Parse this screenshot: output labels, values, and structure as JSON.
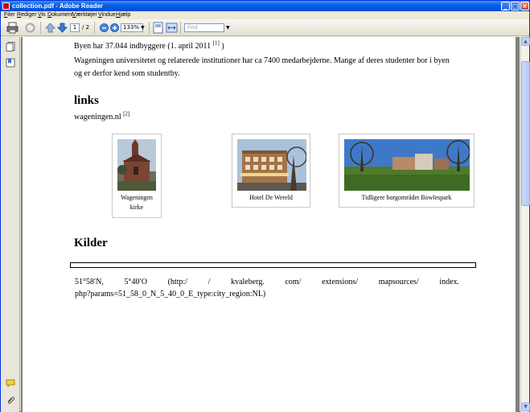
{
  "window": {
    "title": "collection.pdf - Adobe Reader",
    "controls": [
      "_",
      "□",
      "×"
    ]
  },
  "menu": [
    "Filer",
    "Rediger",
    "Vis",
    "Dokument",
    "Værktøjer",
    "Vindue",
    "Hjælp"
  ],
  "toolbar": {
    "page_current": "1",
    "page_total": "/ 2",
    "zoom": "133%",
    "find_placeholder": "Find"
  },
  "document": {
    "line1": "Byen har 37.044 indbyggere (1. april 2011 ",
    "line1_ref": "[1]",
    "line1_end": " )",
    "para2_line1": "Wageningen universitetet og relaterede institutioner har ca 7400 medarbejderne. Mange af deres studenter bor i byen",
    "para2_line2": "og er derfor kend som studentby.",
    "links_heading": "links",
    "link_text": "wageningen.nl ",
    "link_ref": "[2]",
    "figures": [
      {
        "caption_line1": "Wageningen",
        "caption_line2": "kirke"
      },
      {
        "caption_line1": "Hotel De Wereld"
      },
      {
        "caption_line1": "Tidligere borgområdet Bowlespark"
      }
    ],
    "kilder_heading": "Kilder",
    "coords_parts": [
      "51°58′N,",
      "5°40′O",
      "(http:/",
      "/",
      "kvaleberg.",
      "com/",
      "extensions/",
      "mapsources/",
      "index."
    ],
    "coords_line2": "php?params=51_58_0_N_5_40_0_E_type:city_region:NL)"
  },
  "colors": {
    "titlebar": "#0054e3",
    "chrome": "#ece9d8",
    "page_bg": "#ffffff",
    "doc_bg": "#808080"
  }
}
